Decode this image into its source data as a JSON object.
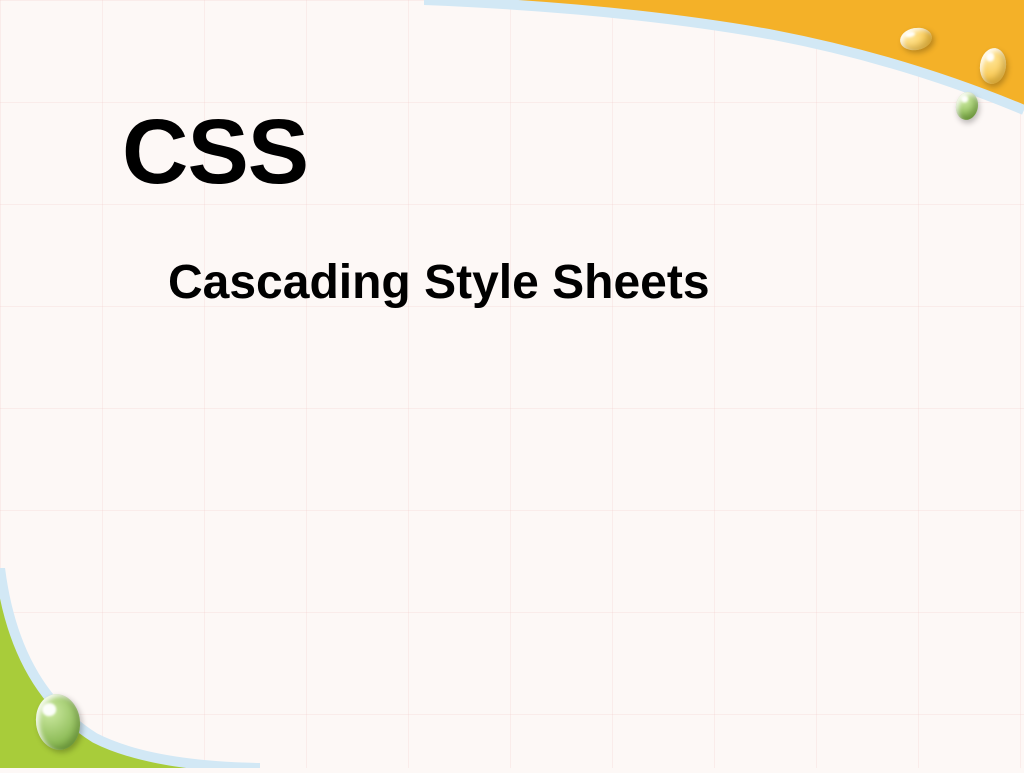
{
  "title": "CSS",
  "subtitle": "Cascading Style Sheets",
  "colors": {
    "accent_top": "#f4b128",
    "accent_bottom": "#a8cc3a",
    "curve_stroke": "#d2e8f5"
  }
}
